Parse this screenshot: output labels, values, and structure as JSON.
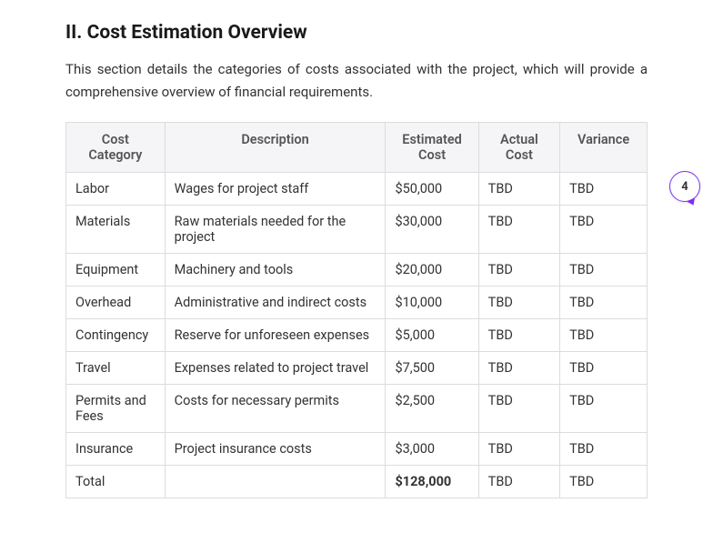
{
  "heading": "II. Cost Estimation Overview",
  "intro": "This section details the categories of costs associated with the project, which will provide a comprehensive overview of financial requirements.",
  "columns": {
    "category": "Cost Category",
    "description": "Description",
    "estimated": "Estimated Cost",
    "actual": "Actual Cost",
    "variance": "Variance"
  },
  "rows": [
    {
      "category": "Labor",
      "description": "Wages for project staff",
      "estimated": "$50,000",
      "actual": "TBD",
      "variance": "TBD"
    },
    {
      "category": "Materials",
      "description": "Raw materials needed for the project",
      "estimated": "$30,000",
      "actual": "TBD",
      "variance": "TBD"
    },
    {
      "category": "Equipment",
      "description": "Machinery and tools",
      "estimated": "$20,000",
      "actual": "TBD",
      "variance": "TBD"
    },
    {
      "category": "Overhead",
      "description": "Administrative and indirect costs",
      "estimated": "$10,000",
      "actual": "TBD",
      "variance": "TBD"
    },
    {
      "category": "Contingency",
      "description": "Reserve for unforeseen expenses",
      "estimated": "$5,000",
      "actual": "TBD",
      "variance": "TBD"
    },
    {
      "category": "Travel",
      "description": "Expenses related to project travel",
      "estimated": "$7,500",
      "actual": "TBD",
      "variance": "TBD"
    },
    {
      "category": "Permits and Fees",
      "description": "Costs for necessary permits",
      "estimated": "$2,500",
      "actual": "TBD",
      "variance": "TBD"
    },
    {
      "category": "Insurance",
      "description": "Project insurance costs",
      "estimated": "$3,000",
      "actual": "TBD",
      "variance": "TBD"
    }
  ],
  "total": {
    "category": "Total",
    "description": "",
    "estimated": "$128,000",
    "actual": "TBD",
    "variance": "TBD"
  },
  "comment_count": "4"
}
